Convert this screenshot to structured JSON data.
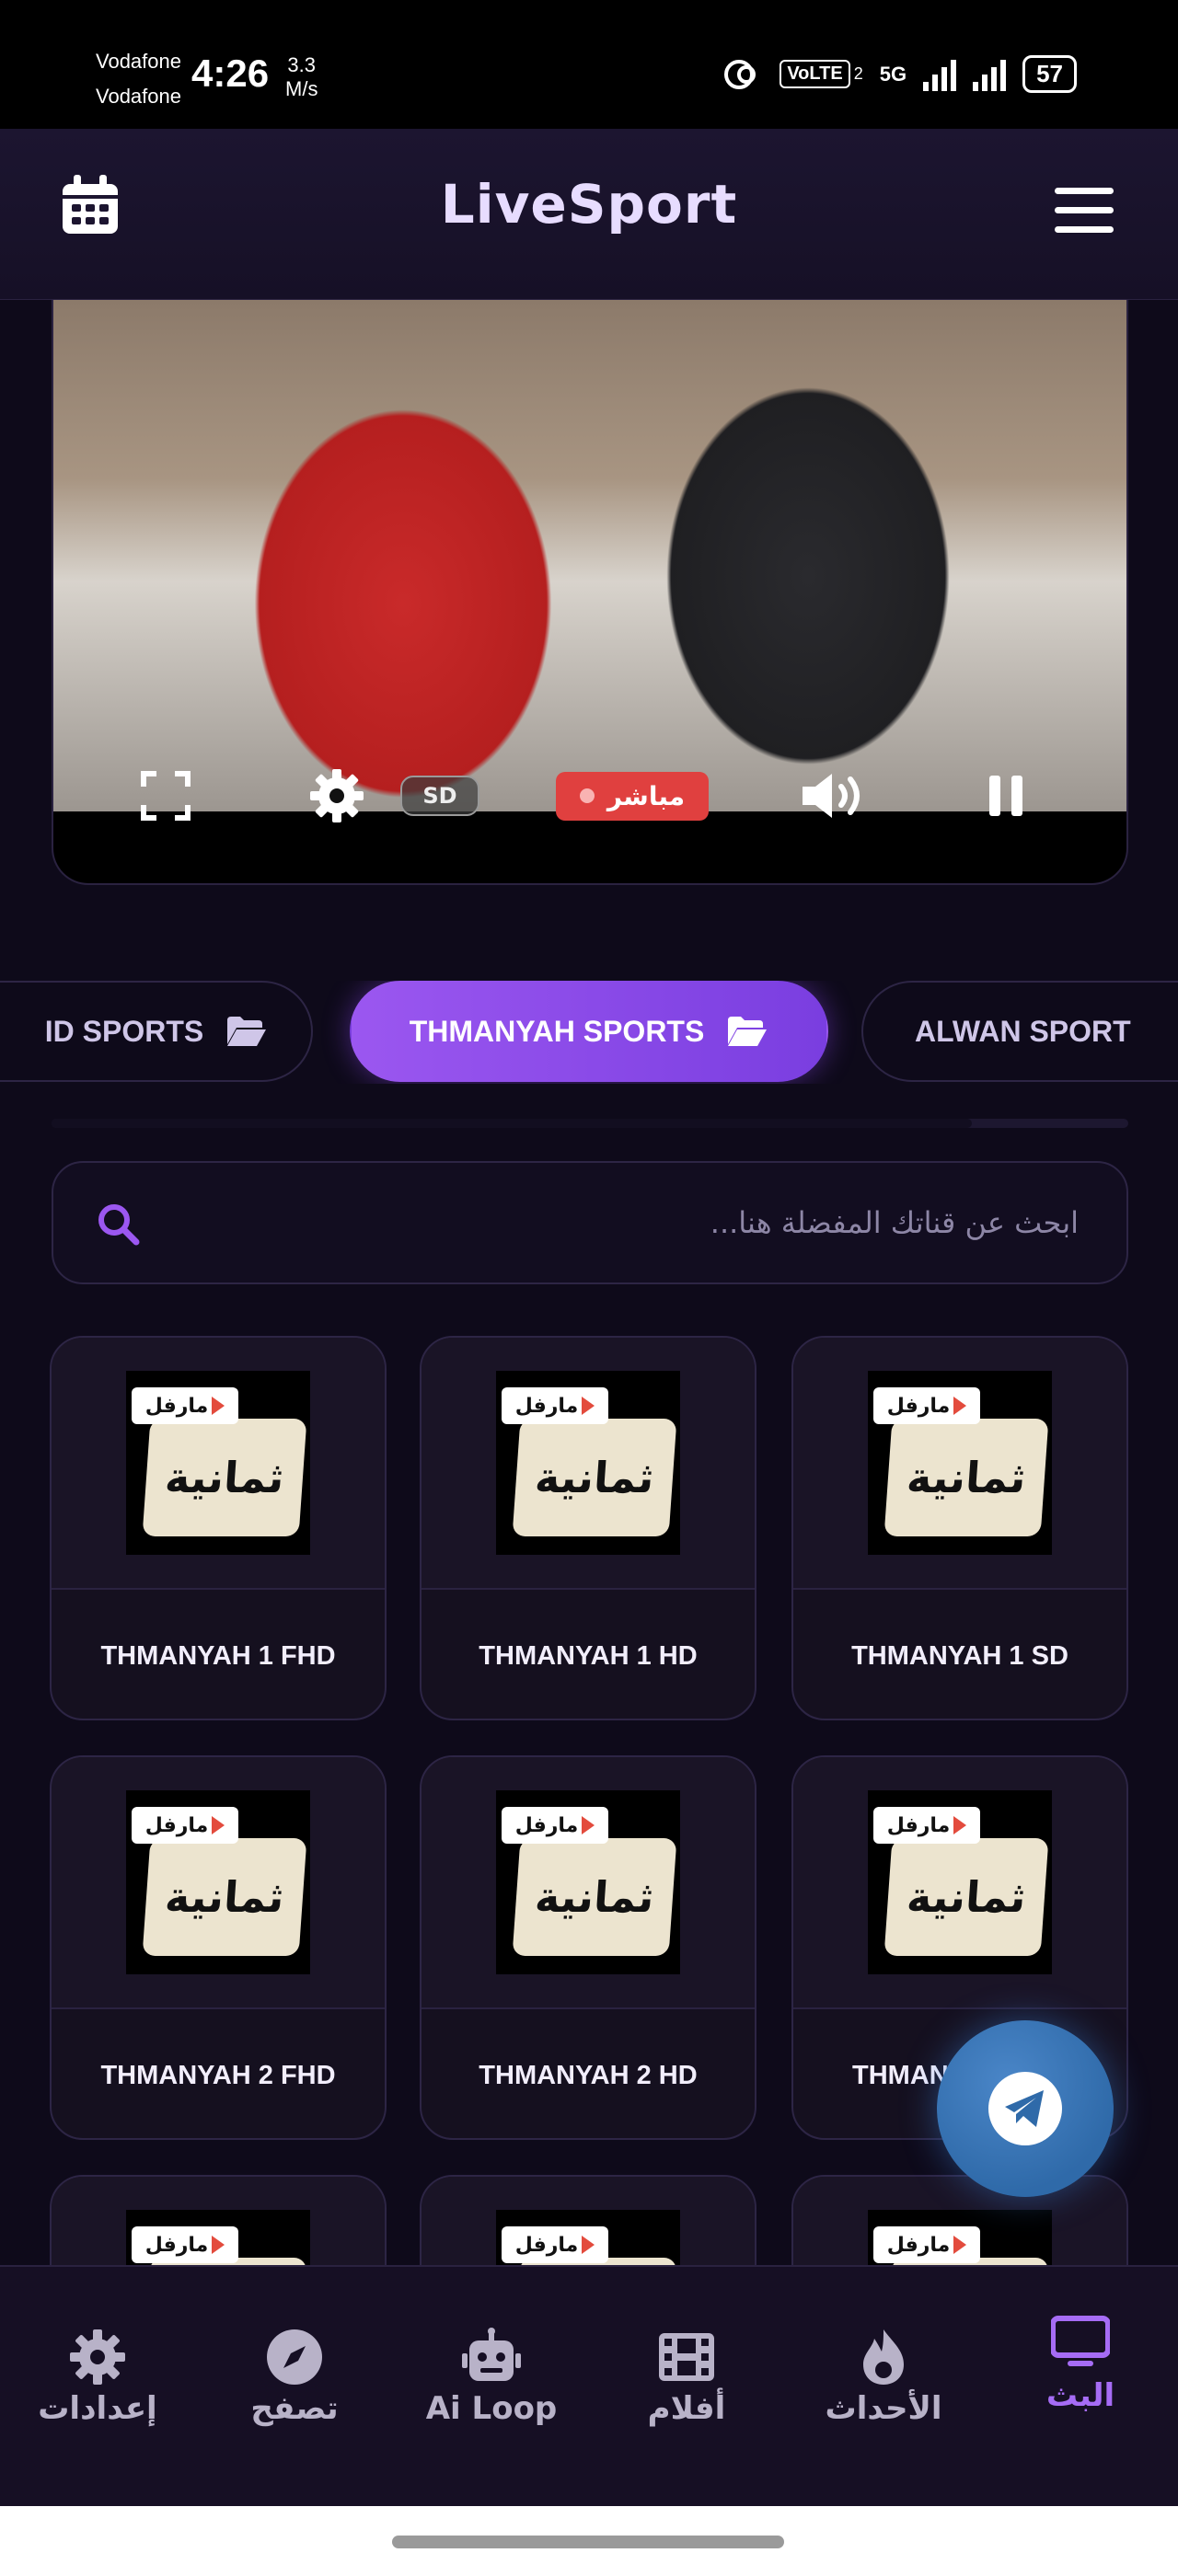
{
  "status_bar": {
    "carrier_1": "Vodafone",
    "carrier_2": "Vodafone",
    "time": "4:26",
    "net_speed_value": "3.3",
    "net_speed_unit": "M/s",
    "volte": "VoLTE",
    "sim_index": "2",
    "network": "5G",
    "battery": "57"
  },
  "header": {
    "title": "LiveSport",
    "calendar_icon": "calendar-icon",
    "menu_icon": "menu-icon"
  },
  "player": {
    "quality": "SD",
    "live_label": "مباشر",
    "icons": [
      "fullscreen-icon",
      "settings-icon",
      "volume-icon",
      "pause-icon"
    ]
  },
  "categories": [
    {
      "label": "ID SPORTS",
      "icon": "folder-icon",
      "active": false
    },
    {
      "label": "THMANYAH SPORTS",
      "icon": "folder-icon",
      "active": true
    },
    {
      "label": "ALWAN SPORT",
      "icon": "folder-icon",
      "active": false
    }
  ],
  "search": {
    "placeholder": "ابحث عن قناتك المفضلة هنا..."
  },
  "channel_logo": {
    "tag": "مارفل",
    "name": "ثمانية"
  },
  "channels": [
    {
      "name": "THMANYAH 1 FHD"
    },
    {
      "name": "THMANYAH 1 HD"
    },
    {
      "name": "THMANYAH 1 SD"
    },
    {
      "name": "THMANYAH 2 FHD"
    },
    {
      "name": "THMANYAH 2 HD"
    },
    {
      "name": "THMAN"
    }
  ],
  "fab": {
    "icon": "telegram-icon"
  },
  "bottom_nav": [
    {
      "label": "إعدادات",
      "icon": "gear-icon",
      "active": false
    },
    {
      "label": "تصفح",
      "icon": "compass-icon",
      "active": false
    },
    {
      "label": "Ai Loop",
      "icon": "robot-icon",
      "active": false
    },
    {
      "label": "أفلام",
      "icon": "film-icon",
      "active": false
    },
    {
      "label": "الأحداث",
      "icon": "fire-icon",
      "active": false
    },
    {
      "label": "البث",
      "icon": "tv-icon",
      "active": true
    }
  ],
  "colors": {
    "accent": "#9b57f0",
    "live_red": "#e0403f",
    "background": "#0e0a1a",
    "fab_blue": "#2f6aa9"
  }
}
